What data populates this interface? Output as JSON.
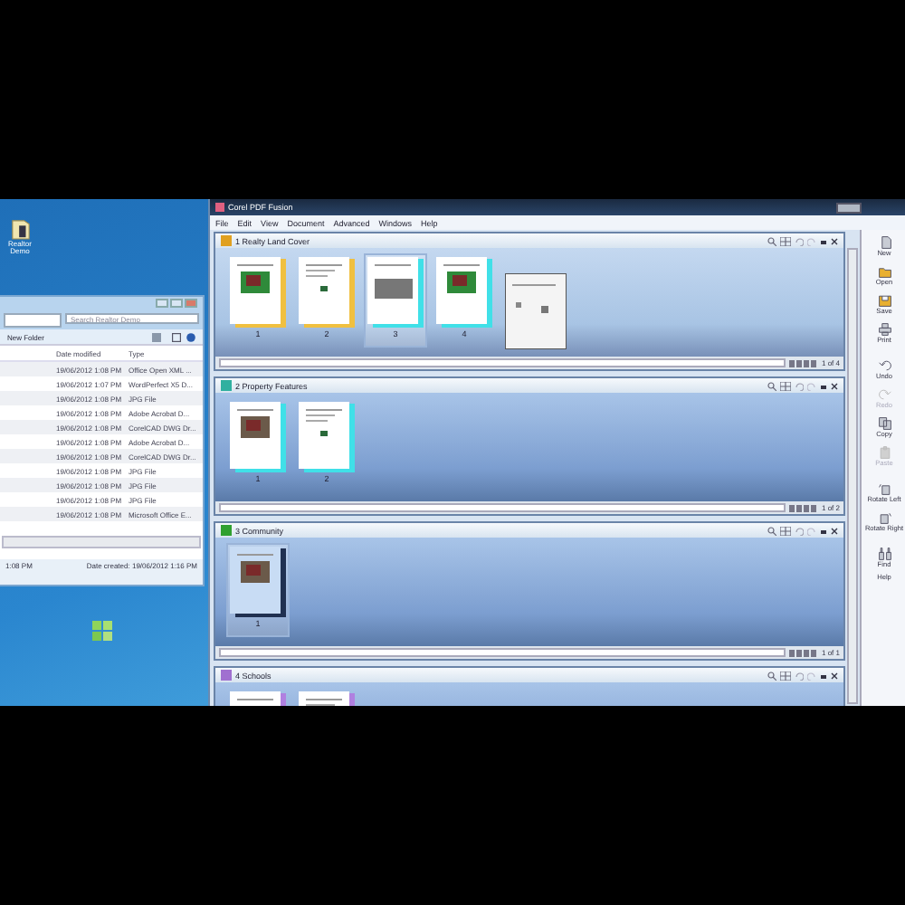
{
  "desktop_icons": [
    {
      "label": "Realtor Demo"
    }
  ],
  "explorer": {
    "search": {
      "placeholder": "Search Realtor Demo"
    },
    "toolbar": [
      "New Folder"
    ],
    "columns": [
      "Date modified",
      "Type"
    ],
    "rows": [
      {
        "date": "19/06/2012 1:08 PM",
        "type": "Office Open XML ..."
      },
      {
        "date": "19/06/2012 1:07 PM",
        "type": "WordPerfect X5 D..."
      },
      {
        "date": "19/06/2012 1:08 PM",
        "type": "JPG File"
      },
      {
        "date": "19/06/2012 1:08 PM",
        "type": "Adobe Acrobat D..."
      },
      {
        "date": "19/06/2012 1:08 PM",
        "type": "CorelCAD DWG Dr..."
      },
      {
        "date": "19/06/2012 1:08 PM",
        "type": "Adobe Acrobat D..."
      },
      {
        "date": "19/06/2012 1:08 PM",
        "type": "CorelCAD DWG Dr..."
      },
      {
        "date": "19/06/2012 1:08 PM",
        "type": "JPG File"
      },
      {
        "date": "19/06/2012 1:08 PM",
        "type": "JPG File"
      },
      {
        "date": "19/06/2012 1:08 PM",
        "type": "JPG File"
      },
      {
        "date": "19/06/2012 1:08 PM",
        "type": "Microsoft Office E..."
      }
    ],
    "details": {
      "modified": "1:08 PM",
      "created": "Date created: 19/06/2012 1:16 PM"
    }
  },
  "pdf": {
    "window": {
      "title": "Corel PDF Fusion"
    },
    "menu": [
      "File",
      "Edit",
      "View",
      "Document",
      "Advanced",
      "Windows",
      "Help"
    ],
    "panels": [
      {
        "title": "1 Realty Land Cover",
        "color": "#e0a020",
        "page_count": "1 of 4",
        "pages": [
          {
            "number": "1",
            "color": "#f0c040",
            "selected": false
          },
          {
            "number": "2",
            "color": "#f0c040",
            "selected": false
          },
          {
            "number": "3",
            "color": "#40e0e8",
            "selected": true
          },
          {
            "number": "4",
            "color": "#40e0e8",
            "selected": false
          }
        ]
      },
      {
        "title": "2 Property Features",
        "color": "#30b0a0",
        "page_count": "1 of 2",
        "pages": [
          {
            "number": "1",
            "color": "#40e0e8",
            "selected": false
          },
          {
            "number": "2",
            "color": "#40e0e8",
            "selected": false
          }
        ]
      },
      {
        "title": "3 Community",
        "color": "#30a030",
        "page_count": "1 of 1",
        "pages": [
          {
            "number": "1",
            "color": "#203050",
            "selected": true
          }
        ]
      },
      {
        "title": "4 Schools",
        "color": "#a070d0",
        "pages": [
          {
            "color": "#b080e0",
            "selected": false
          },
          {
            "color": "#b080e0",
            "selected": false
          }
        ]
      }
    ],
    "tools": [
      {
        "label": "New",
        "disabled": false
      },
      {
        "label": "Open",
        "disabled": false
      },
      {
        "label": "Save",
        "disabled": false
      },
      {
        "label": "Print",
        "disabled": false
      },
      {
        "label": "Undo",
        "disabled": false
      },
      {
        "label": "Redo",
        "disabled": true
      },
      {
        "label": "Copy",
        "disabled": false
      },
      {
        "label": "Paste",
        "disabled": true
      },
      {
        "label": "Rotate Left",
        "disabled": false
      },
      {
        "label": "Rotate Right",
        "disabled": false
      },
      {
        "label": "Find",
        "disabled": false
      },
      {
        "label": "Help",
        "disabled": false
      }
    ]
  }
}
